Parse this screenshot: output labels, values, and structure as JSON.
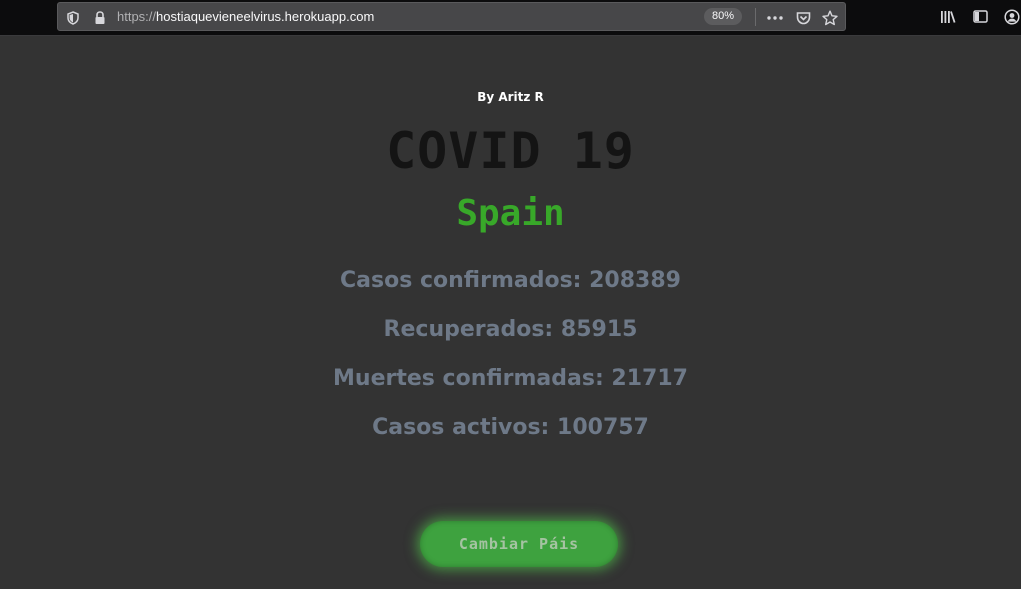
{
  "browser": {
    "url_protocol": "https://",
    "url_host": "hostiaquevieneelvirus.herokuapp.com",
    "zoom": "80%",
    "icons": [
      "shield-icon",
      "lock-icon",
      "more-icon",
      "pocket-icon",
      "star-icon",
      "library-icon",
      "sidebar-icon",
      "account-icon"
    ]
  },
  "page": {
    "author": "By Aritz R",
    "title": "COVID 19",
    "country": "Spain",
    "stats": {
      "confirmed": "Casos confirmados: 208389",
      "recovered": "Recuperados: 85915",
      "deaths": "Muertes confirmadas: 21717",
      "active": "Casos activos: 100757"
    },
    "button_label": "Cambiar Páis"
  },
  "colors": {
    "background": "#333333",
    "title": "#141414",
    "country": "#38a829",
    "stats": "#6e7988",
    "button": "#3ea23f"
  }
}
